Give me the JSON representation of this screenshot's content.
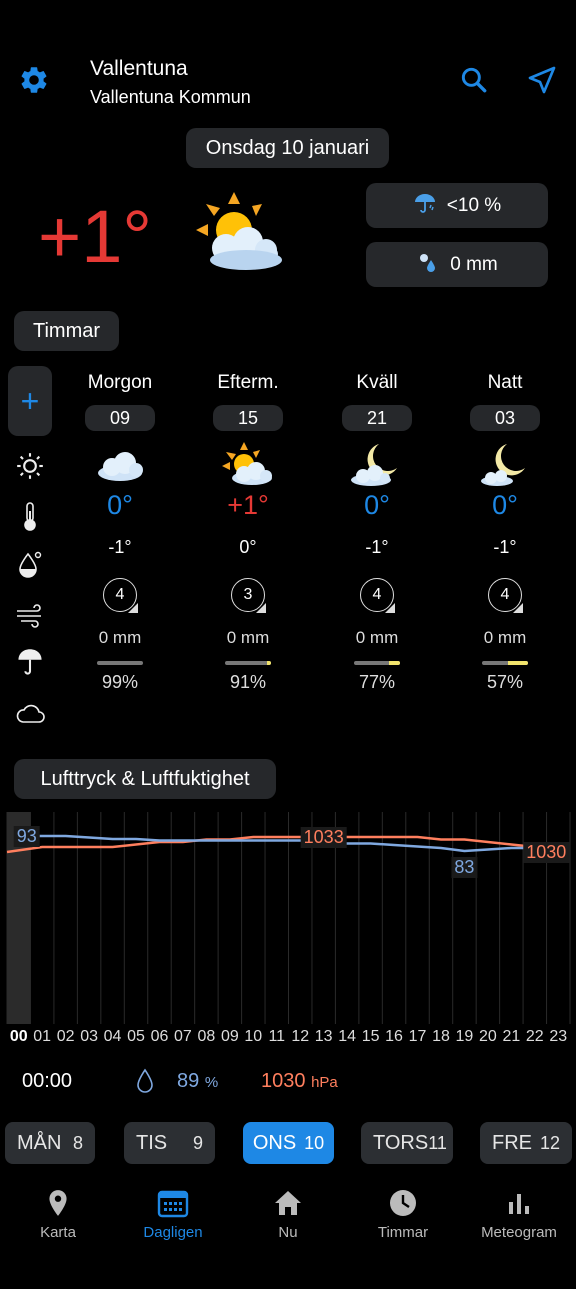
{
  "header": {
    "city": "Vallentuna",
    "region": "Vallentuna Kommun",
    "date": "Onsdag 10 januari"
  },
  "current": {
    "temperature": "+1°",
    "precip_chance": "<10 %",
    "precip_amount": "0 mm"
  },
  "hours_section": {
    "title": "Timmar",
    "add_label": "+",
    "columns": [
      {
        "label": "Morgon",
        "hour": "09",
        "temp": "0°",
        "temp_color": "#1e88e5",
        "feels": "-1°",
        "wind": "4",
        "precip": "0 mm",
        "cloud": "99%",
        "cloud_fraction": 0.99,
        "sun_fraction": 0.0
      },
      {
        "label": "Efterm.",
        "hour": "15",
        "temp": "+1°",
        "temp_color": "#e53935",
        "feels": "0°",
        "wind": "3",
        "precip": "0 mm",
        "cloud": "91%",
        "cloud_fraction": 0.91,
        "sun_fraction": 0.09
      },
      {
        "label": "Kväll",
        "hour": "21",
        "temp": "0°",
        "temp_color": "#1e88e5",
        "feels": "-1°",
        "wind": "4",
        "precip": "0 mm",
        "cloud": "77%",
        "cloud_fraction": 0.77,
        "sun_fraction": 0.23
      },
      {
        "label": "Natt",
        "hour": "03",
        "temp": "0°",
        "temp_color": "#1e88e5",
        "feels": "-1°",
        "wind": "4",
        "precip": "0 mm",
        "cloud": "57%",
        "cloud_fraction": 0.57,
        "sun_fraction": 0.43
      }
    ]
  },
  "pressure_section": {
    "title": "Lufttryck & Luftfuktighet"
  },
  "chart_data": {
    "type": "line",
    "x": [
      "00",
      "01",
      "02",
      "03",
      "04",
      "05",
      "06",
      "07",
      "08",
      "09",
      "10",
      "11",
      "12",
      "13",
      "14",
      "15",
      "16",
      "17",
      "18",
      "19",
      "20",
      "21",
      "22",
      "23"
    ],
    "series": [
      {
        "color": "#ff7f5e",
        "values": [
          1030,
          1031,
          1031,
          1031,
          1031,
          1031.5,
          1032,
          1032,
          1032.5,
          1032.5,
          1033,
          1033,
          1033,
          1033,
          1033,
          1033,
          1033,
          1033,
          1032.5,
          1032.5,
          1032,
          1031.5,
          1031,
          1030
        ]
      },
      {
        "color": "#7fa8e0",
        "values": [
          93,
          93,
          93,
          92,
          91,
          91,
          90,
          90,
          90,
          90,
          90,
          90,
          90,
          89,
          88,
          88,
          87,
          86,
          85,
          83,
          84,
          85,
          85,
          85
        ]
      }
    ],
    "labels": [
      {
        "text": "93",
        "series": 1,
        "index": 0
      },
      {
        "text": "1033",
        "series": 0,
        "index": 13
      },
      {
        "text": "83",
        "series": 1,
        "index": 19
      },
      {
        "text": "1030",
        "series": 0,
        "index": 23
      }
    ],
    "selected_index": 0
  },
  "readout": {
    "time": "00:00",
    "humidity": "89",
    "humidity_unit": "%",
    "pressure": "1030",
    "pressure_unit": "hPa"
  },
  "days": [
    {
      "name": "MÅN",
      "num": "8",
      "active": false
    },
    {
      "name": "TIS",
      "num": "9",
      "active": false
    },
    {
      "name": "ONS",
      "num": "10",
      "active": true
    },
    {
      "name": "TORS",
      "num": "11",
      "active": false
    },
    {
      "name": "FRE",
      "num": "12",
      "active": false
    }
  ],
  "nav": [
    {
      "label": "Karta",
      "icon": "map-pin-icon"
    },
    {
      "label": "Dagligen",
      "icon": "calendar-icon",
      "active": true
    },
    {
      "label": "Nu",
      "icon": "home-icon"
    },
    {
      "label": "Timmar",
      "icon": "clock-icon"
    },
    {
      "label": "Meteogram",
      "icon": "bar-chart-icon"
    }
  ]
}
